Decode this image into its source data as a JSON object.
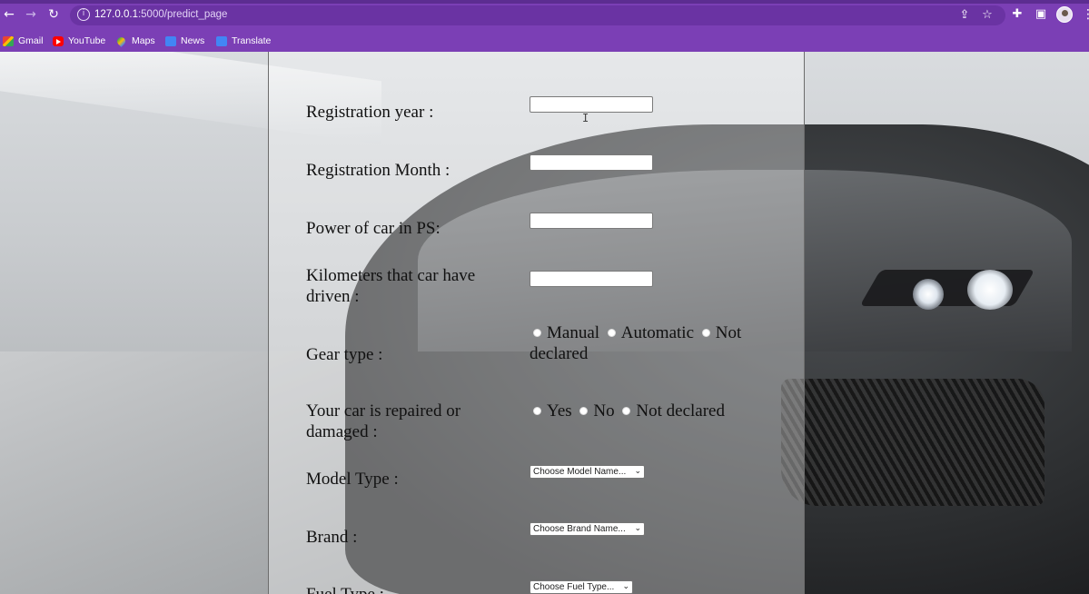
{
  "browser": {
    "url_host": "127.0.0.1",
    "url_rest": ":5000/predict_page",
    "bookmarks": [
      {
        "label": "Gmail",
        "icon": "gmail-icon"
      },
      {
        "label": "YouTube",
        "icon": "youtube-icon"
      },
      {
        "label": "Maps",
        "icon": "maps-icon"
      },
      {
        "label": "News",
        "icon": "news-icon"
      },
      {
        "label": "Translate",
        "icon": "translate-icon"
      }
    ],
    "accent_color": "#7b3fb5"
  },
  "form": {
    "registration_year_label": "Registration year :",
    "registration_month_label": "Registration Month :",
    "power_label": "Power of car in PS:",
    "kilometers_label": "Kilometers that car have driven :",
    "gear_label": "Gear type :",
    "gear_options": [
      "Manual",
      "Automatic",
      "Not declared"
    ],
    "repaired_label": "Your car is repaired or damaged :",
    "repaired_options": [
      "Yes",
      "No",
      "Not declared"
    ],
    "model_label": "Model Type :",
    "model_select": "Choose Model Name...",
    "brand_label": "Brand :",
    "brand_select": "Choose Brand Name...",
    "fuel_label": "Fuel Type :",
    "fuel_select": "Choose Fuel Type..."
  }
}
